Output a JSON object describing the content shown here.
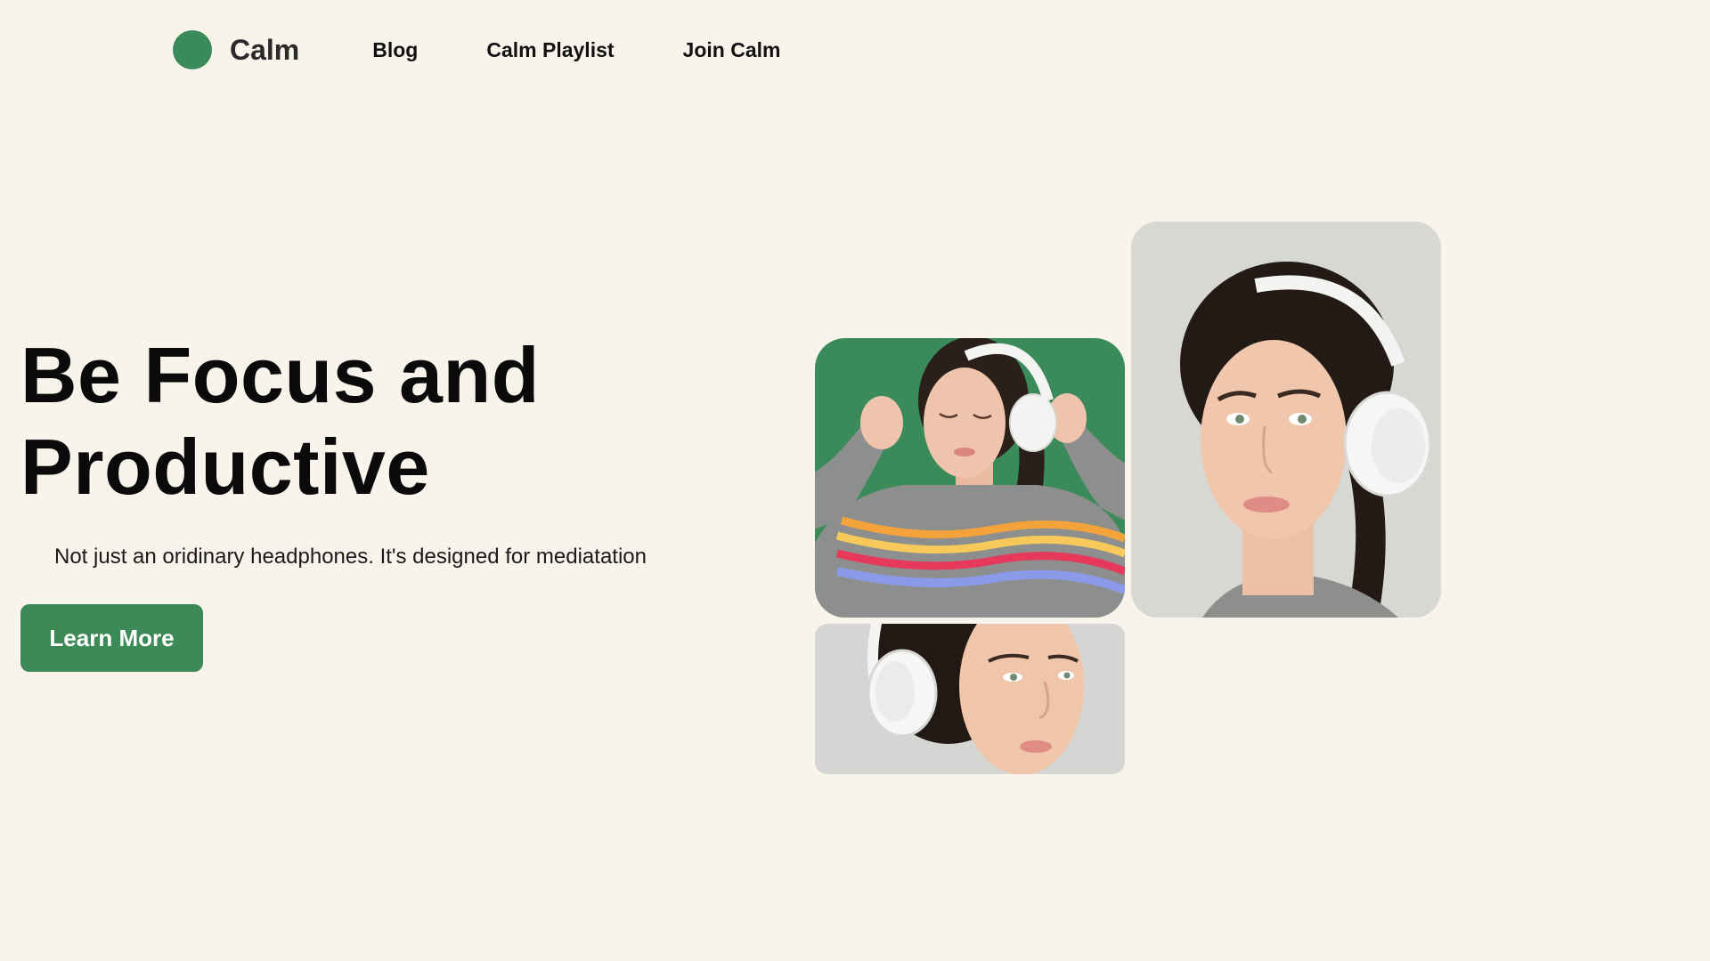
{
  "brand": {
    "name": "Calm",
    "logo_color": "#3a8a5a",
    "logo_icon": "green-circle-logo-icon"
  },
  "nav": {
    "items": [
      {
        "label": "Blog"
      },
      {
        "label": "Calm Playlist"
      },
      {
        "label": "Join Calm"
      }
    ]
  },
  "hero": {
    "title_line1": "Be Focus and",
    "title_line2": "Productive",
    "subtitle": "Not just an oridinary headphones. It's designed for mediatation",
    "cta_label": "Learn More",
    "cta_color": "#3c8a58"
  },
  "gallery": {
    "images": [
      {
        "name": "woman-with-headphones-green-background",
        "bg_color": "#3a8a5a"
      },
      {
        "name": "woman-with-headphones-portrait",
        "bg_color": "#d7d7d4"
      },
      {
        "name": "woman-with-headphones-side-profile",
        "bg_color": "#d5d5d3"
      }
    ]
  }
}
